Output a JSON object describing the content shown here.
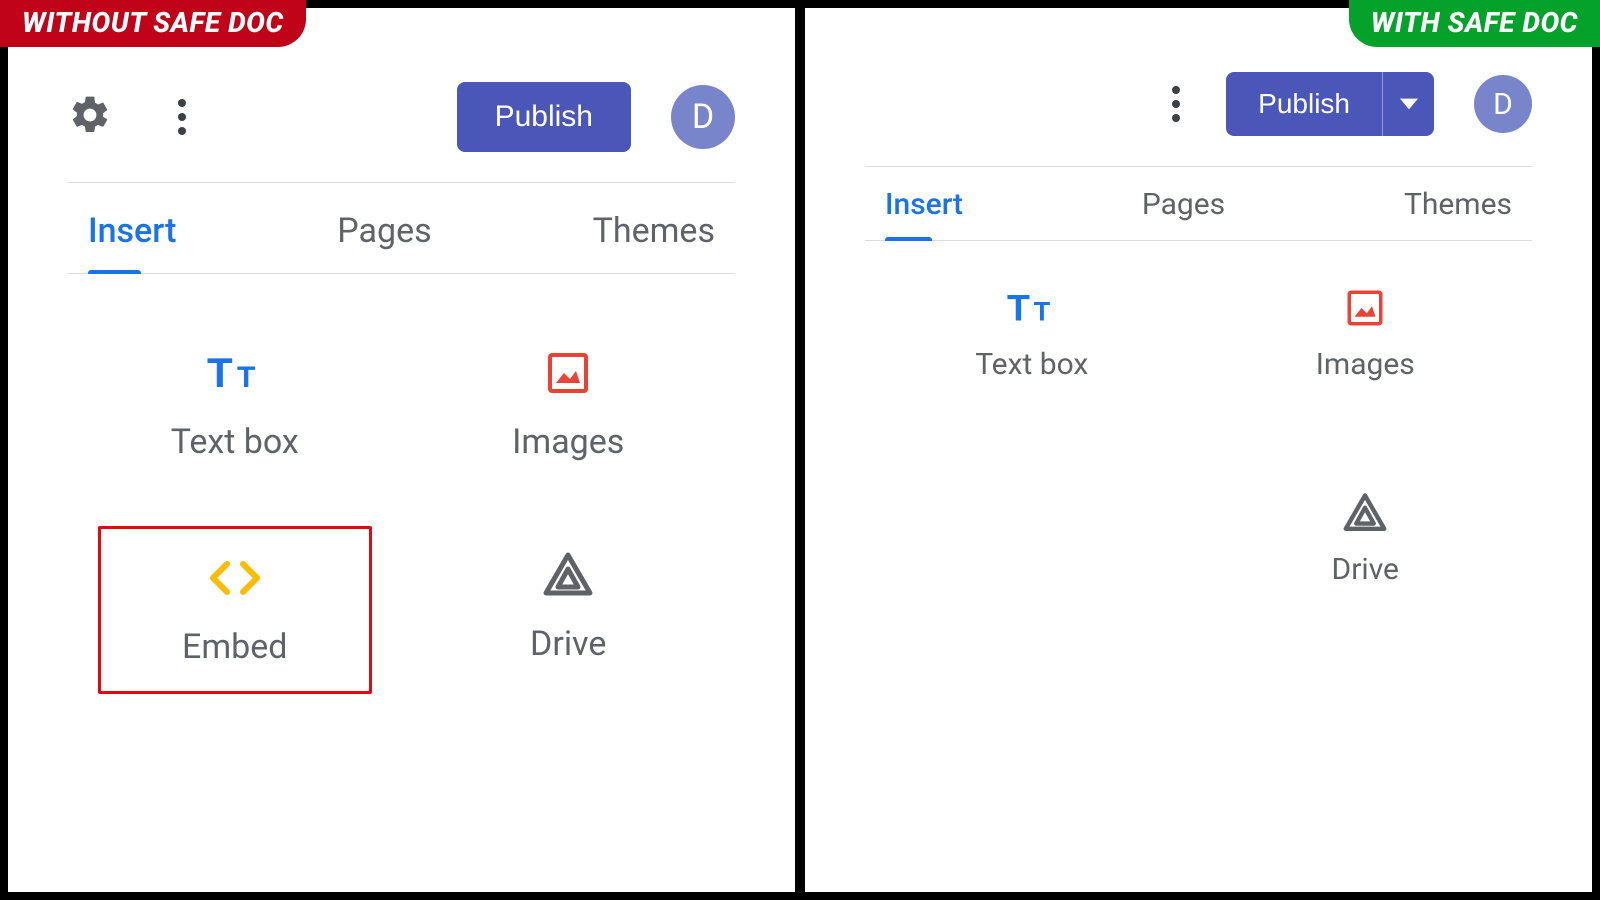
{
  "comparison": {
    "left_label": "WITHOUT SAFE DOC",
    "right_label": "WITH SAFE DOC"
  },
  "toolbar": {
    "publish_label": "Publish",
    "avatar_initial": "D"
  },
  "tabs": {
    "insert": "Insert",
    "pages": "Pages",
    "themes": "Themes"
  },
  "tiles": {
    "textbox": "Text box",
    "images": "Images",
    "embed": "Embed",
    "drive": "Drive"
  }
}
